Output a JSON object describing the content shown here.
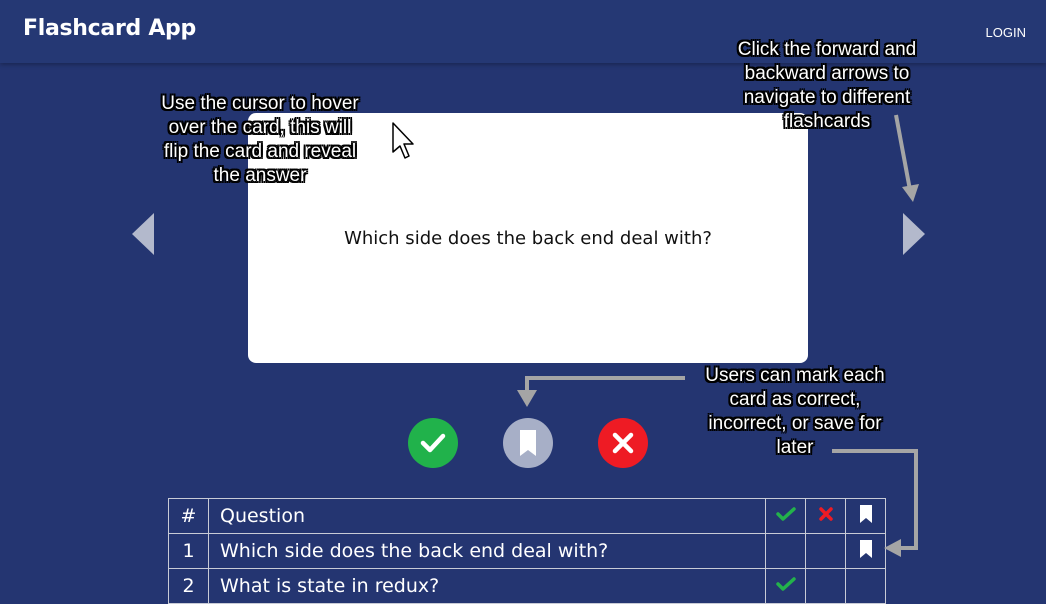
{
  "navbar": {
    "brand": "Flashcard App",
    "login_label": "LOGIN"
  },
  "card": {
    "question": "Which side does the back end deal with?"
  },
  "navigation": {
    "prev_icon": "triangle-left-icon",
    "next_icon": "triangle-right-icon"
  },
  "actions": {
    "correct_icon": "check-icon",
    "save_icon": "bookmark-icon",
    "incorrect_icon": "x-icon",
    "colors": {
      "correct": "#21b24b",
      "save": "#a7afc7",
      "incorrect": "#ee1b24"
    }
  },
  "annotations": {
    "hover": [
      "Use the cursor to hover",
      "over the card, this will",
      "flip the card and reveal",
      "the answer"
    ],
    "navigate": [
      "Click the forward and",
      "backward arrows to",
      "navigate to different",
      "flashcards"
    ],
    "mark": [
      "Users can mark each",
      "card as correct,",
      "incorrect, or save for",
      "later"
    ]
  },
  "table": {
    "headers": {
      "number": "#",
      "question": "Question",
      "correct_icon": "check-icon",
      "incorrect_icon": "x-icon",
      "saved_icon": "bookmark-icon"
    },
    "rows": [
      {
        "number": "1",
        "question": "Which side does the back end deal with?",
        "correct": false,
        "incorrect": false,
        "saved": true
      },
      {
        "number": "2",
        "question": "What is state in redux?",
        "correct": true,
        "incorrect": false,
        "saved": false
      }
    ]
  },
  "colors": {
    "background": "#243571",
    "card": "#ffffff",
    "correct": "#23b24b",
    "incorrect": "#ee1b24"
  }
}
